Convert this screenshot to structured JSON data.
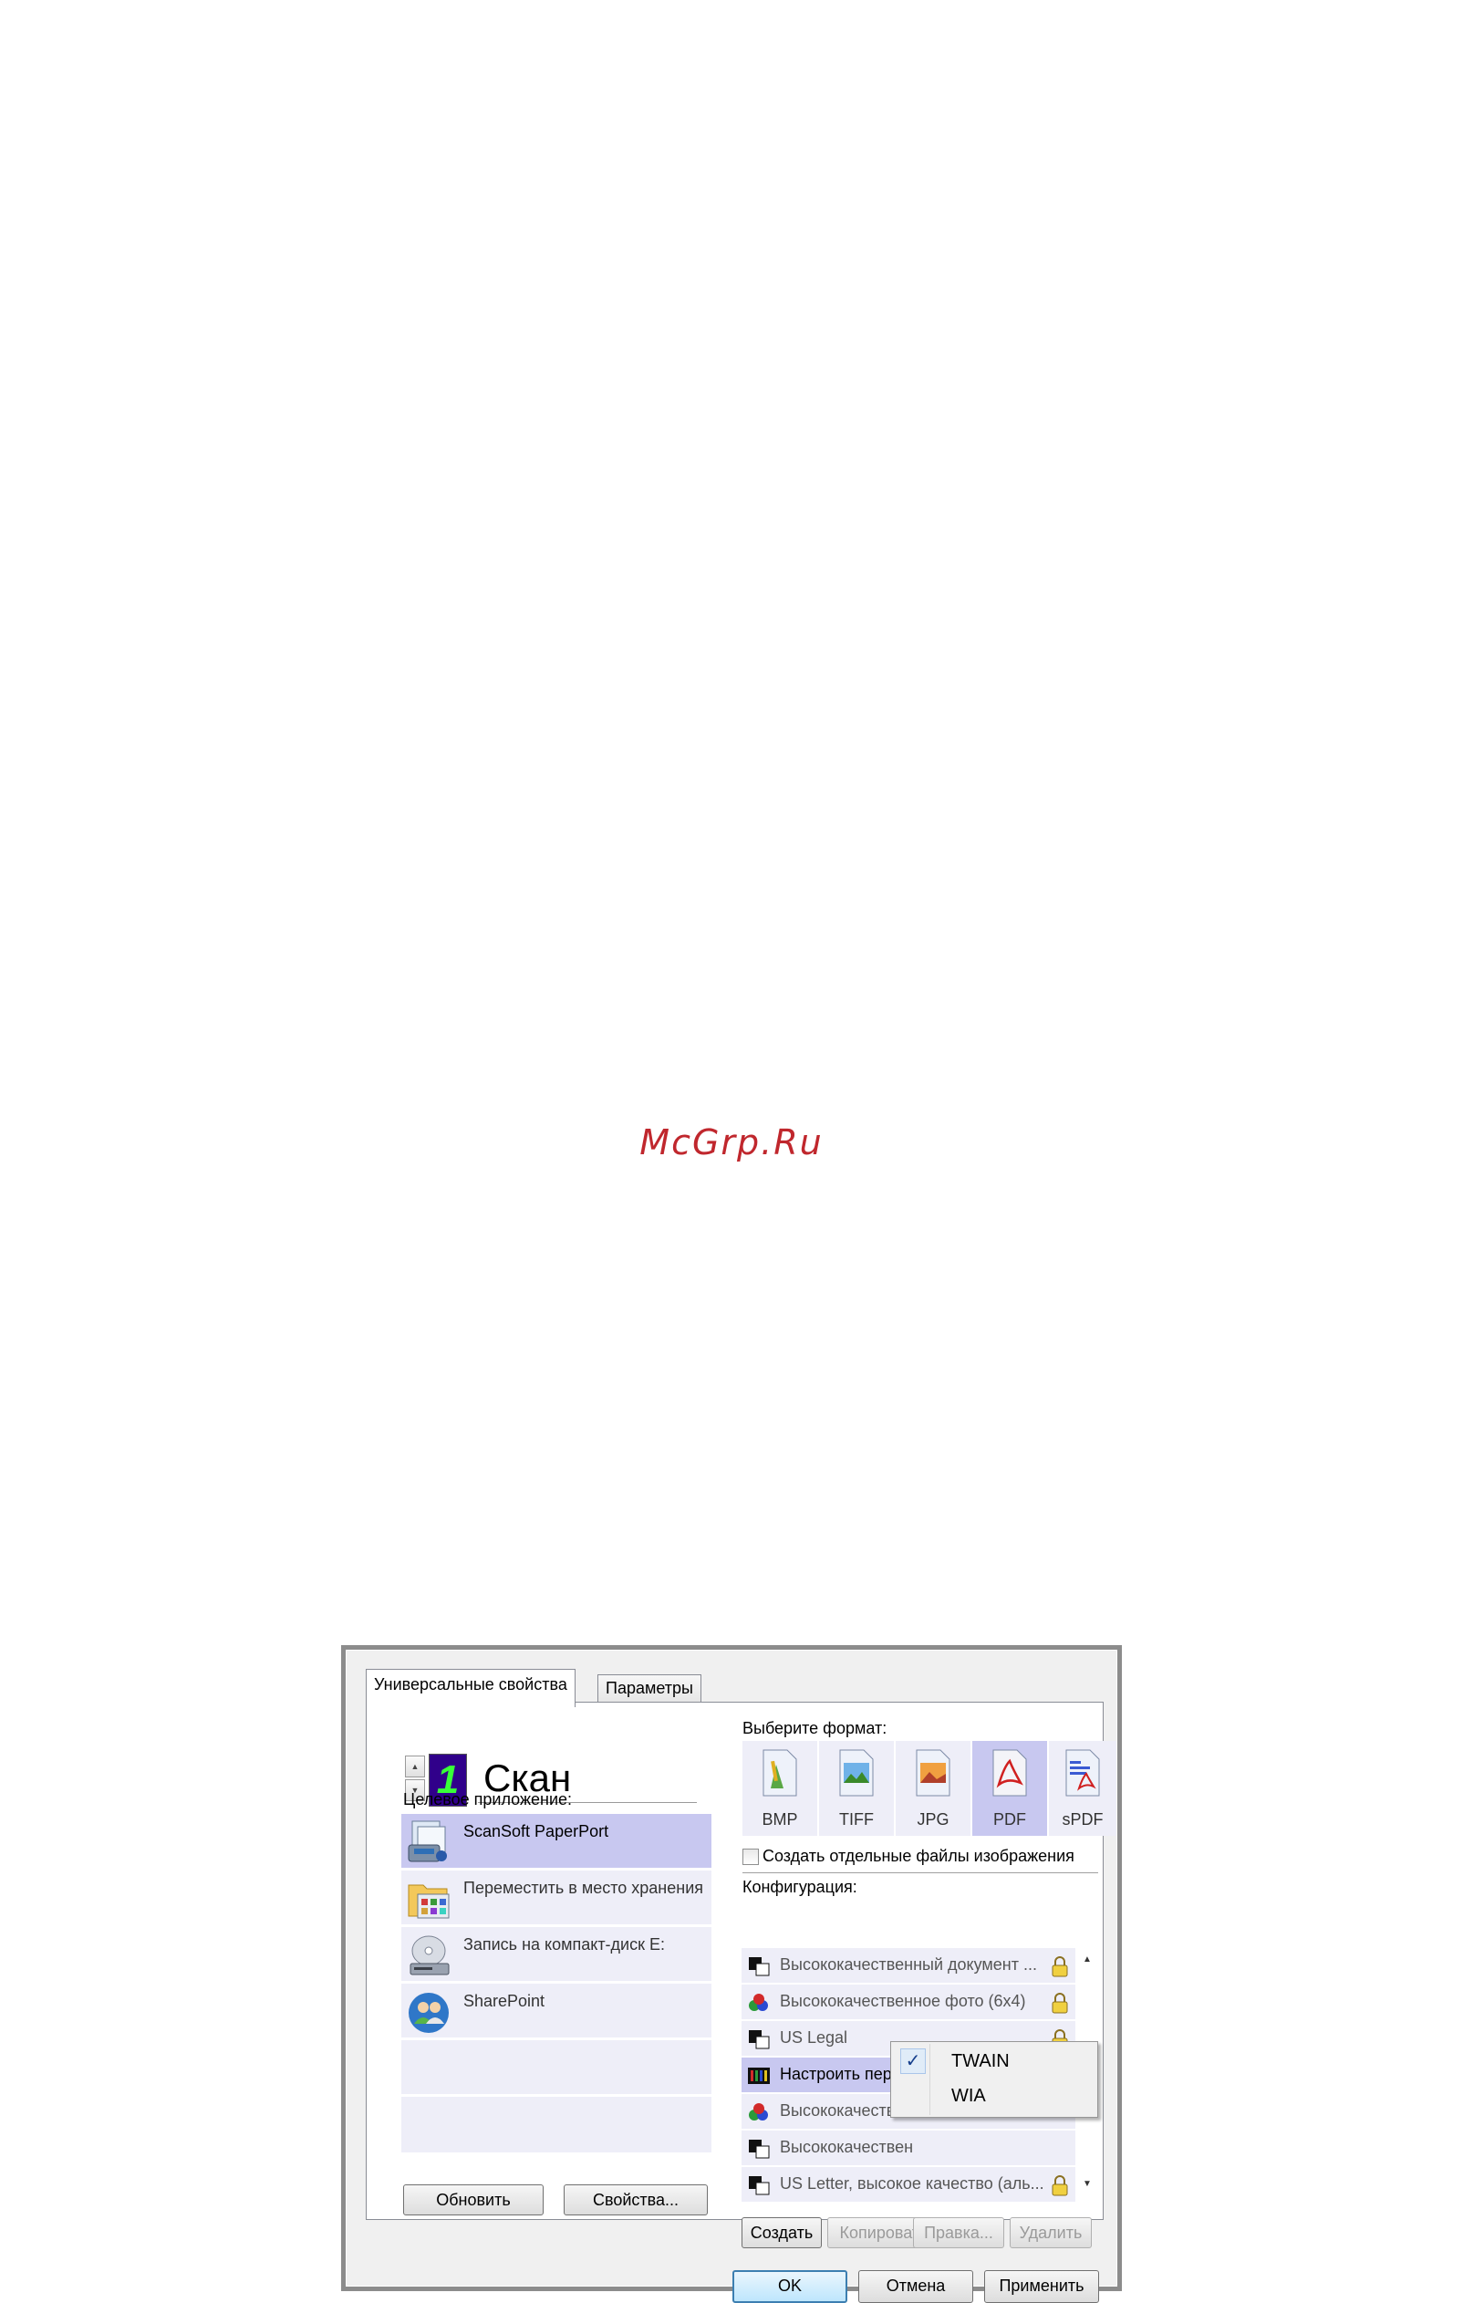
{
  "watermark": "McGrp.Ru",
  "tabs": [
    {
      "label": "Универсальные свойства",
      "active": true
    },
    {
      "label": "Параметры",
      "active": false
    }
  ],
  "scan_name": "Скан",
  "scan_digit": "1",
  "destination": {
    "label": "Целевое приложение:",
    "items": [
      {
        "label": "ScanSoft PaperPort",
        "icon": "paperport-icon",
        "selected": true
      },
      {
        "label": "Переместить в место хранения",
        "icon": "storage-folder-icon",
        "selected": false
      },
      {
        "label": "Запись на компакт-диск  E:",
        "icon": "cd-burn-icon",
        "selected": false
      },
      {
        "label": "SharePoint",
        "icon": "sharepoint-icon",
        "selected": false
      }
    ]
  },
  "format": {
    "label": "Выберите формат:",
    "items": [
      {
        "label": "BMP",
        "selected": false
      },
      {
        "label": "TIFF",
        "selected": false
      },
      {
        "label": "JPG",
        "selected": false
      },
      {
        "label": "PDF",
        "selected": true
      },
      {
        "label": "sPDF",
        "selected": false
      }
    ],
    "separate_files_label": "Создать отдельные файлы изображения",
    "separate_files_checked": false
  },
  "config": {
    "label": "Конфигурация:",
    "items": [
      {
        "label": "Высококачественный документ ...",
        "icon": "bw-document-icon",
        "selected": false
      },
      {
        "label": "Высококачественное фото (6x4)",
        "icon": "color-photo-icon",
        "selected": false
      },
      {
        "label": "US Legal",
        "icon": "bw-document-icon",
        "selected": false
      },
      {
        "label": "Настроить перед сканированием",
        "icon": "configure-icon",
        "selected": true
      },
      {
        "label": "Высококачествен",
        "icon": "color-photo-icon",
        "selected": false
      },
      {
        "label": "Высококачествен",
        "icon": "bw-document-icon",
        "selected": false
      },
      {
        "label": "US Letter, высокое качество (аль...",
        "icon": "bw-document-icon",
        "selected": false
      }
    ]
  },
  "popup_menu": [
    {
      "label": "TWAIN",
      "checked": true
    },
    {
      "label": "WIA",
      "checked": false
    }
  ],
  "left_buttons": {
    "refresh": "Обновить",
    "properties": "Свойства..."
  },
  "config_buttons": {
    "create": "Создать",
    "copy": "Копировать",
    "edit": "Правка...",
    "delete": "Удалить"
  },
  "dialog_buttons": {
    "ok": "OK",
    "cancel": "Отмена",
    "apply": "Применить"
  },
  "colors": {
    "selection": "#c8c8f0",
    "list_bg": "#eeeef8",
    "watermark": "#c0272d",
    "digit_bg": "#30008a",
    "digit_fg": "#38ff38"
  }
}
